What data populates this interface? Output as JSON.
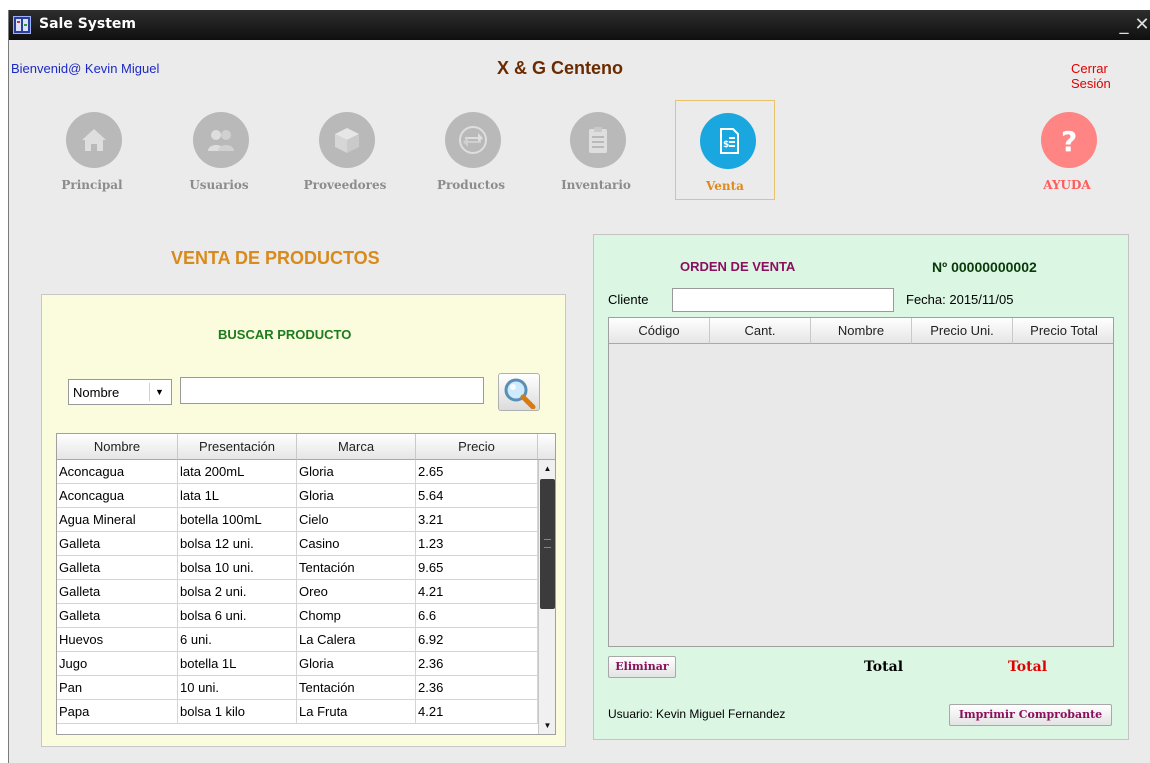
{
  "window": {
    "title": "Sale System",
    "minimize_symbol": "_",
    "close_symbol": "✕",
    "icon": "app-icon"
  },
  "header": {
    "welcome": "Bienvenid@ Kevin Miguel",
    "company": "X & G Centeno",
    "logout": "Cerrar Sesión"
  },
  "nav": {
    "items": [
      {
        "label": "Principal",
        "icon": "home-icon"
      },
      {
        "label": "Usuarios",
        "icon": "users-icon"
      },
      {
        "label": "Proveedores",
        "icon": "box-icon"
      },
      {
        "label": "Productos",
        "icon": "transfer-icon"
      },
      {
        "label": "Inventario",
        "icon": "clipboard-icon"
      },
      {
        "label": "Venta",
        "icon": "invoice-icon",
        "active": true
      },
      {
        "label": "AYUDA",
        "icon": "help-icon"
      }
    ]
  },
  "colors": {
    "accent_venta": "#1aa7e0",
    "ayuda": "#ff8484",
    "panel_buscar": "#fbfcde",
    "panel_orden": "#dcf6e4"
  },
  "venta": {
    "title": "VENTA DE PRODUCTOS"
  },
  "buscar": {
    "title": "BUSCAR PRODUCTO",
    "filter_selected": "Nombre",
    "search_value": "",
    "search_icon": "magnifier-icon",
    "columns": [
      "Nombre",
      "Presentación",
      "Marca",
      "Precio"
    ],
    "rows": [
      [
        "Aconcagua",
        "lata 200mL",
        "Gloria",
        "2.65"
      ],
      [
        "Aconcagua",
        "lata 1L",
        "Gloria",
        "5.64"
      ],
      [
        "Agua Mineral",
        "botella 100mL",
        "Cielo",
        "3.21"
      ],
      [
        "Galleta",
        "bolsa 12 uni.",
        "Casino",
        "1.23"
      ],
      [
        "Galleta",
        "bolsa 10 uni.",
        "Tentación",
        "9.65"
      ],
      [
        "Galleta",
        "bolsa 2 uni.",
        "Oreo",
        "4.21"
      ],
      [
        "Galleta",
        "bolsa 6 uni.",
        "Chomp",
        "6.6"
      ],
      [
        "Huevos",
        "6 uni.",
        "La Calera",
        "6.92"
      ],
      [
        "Jugo",
        "botella 1L",
        "Gloria",
        "2.36"
      ],
      [
        "Pan",
        "10 uni.",
        "Tentación",
        "2.36"
      ],
      [
        "Papa",
        "bolsa 1 kilo",
        "La Fruta",
        "4.21"
      ]
    ]
  },
  "orden": {
    "title": "ORDEN DE VENTA",
    "number": "Nº 00000000002",
    "cliente_label": "Cliente",
    "cliente_value": "",
    "fecha": "Fecha:  2015/11/05",
    "columns": [
      "Código",
      "Cant.",
      "Nombre",
      "Precio Uni.",
      "Precio Total"
    ],
    "eliminar": "Eliminar",
    "total_label": "Total",
    "total_value": "Total",
    "usuario": "Usuario: Kevin Miguel Fernandez",
    "imprimir": "Imprimir Comprobante"
  }
}
